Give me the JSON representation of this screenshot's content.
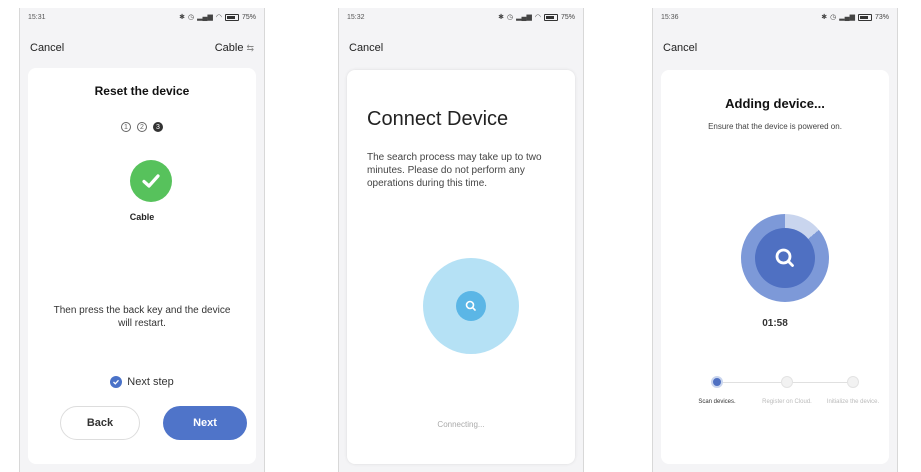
{
  "screen1": {
    "status_time": "15:31",
    "status_battery": "75%",
    "nav_cancel": "Cancel",
    "nav_mode": "Cable",
    "title": "Reset the device",
    "steps": [
      "1",
      "2",
      "3"
    ],
    "active_step": 3,
    "device_label": "Cable",
    "instruction": "Then press the back key and the device will restart.",
    "next_step_label": "Next step",
    "back_button": "Back",
    "next_button": "Next",
    "accent_color": "#4f74c9",
    "success_color": "#57c25c"
  },
  "screen2": {
    "status_time": "15:32",
    "status_battery": "75%",
    "nav_cancel": "Cancel",
    "title": "Connect Device",
    "description": "The search process may take up to two minutes. Please do not perform any operations during this time.",
    "status_text": "Connecting...",
    "pulse_color": "#5bb6e6"
  },
  "screen3": {
    "status_time": "15:36",
    "status_battery": "73%",
    "nav_cancel": "Cancel",
    "title": "Adding device...",
    "subtitle": "Ensure that the device is powered on.",
    "timer": "01:58",
    "progress_steps": [
      {
        "label": "Scan devices.",
        "active": true
      },
      {
        "label": "Register on Cloud.",
        "active": false
      },
      {
        "label": "Initialize the device.",
        "active": false
      }
    ],
    "accent_color": "#4f70c2"
  }
}
